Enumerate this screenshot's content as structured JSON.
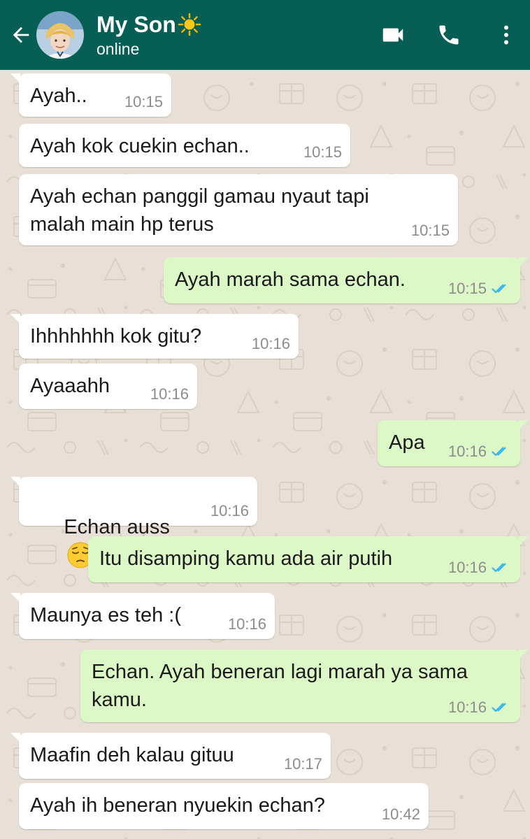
{
  "header": {
    "contact_name": "My Son",
    "status": "online",
    "name_emoji": "sun-icon",
    "icons": [
      "back-arrow-icon",
      "video-call-icon",
      "voice-call-icon",
      "more-options-icon"
    ],
    "colors": {
      "bar": "#075e54",
      "text": "#ffffff"
    }
  },
  "messages": [
    {
      "dir": "in",
      "text": "Ayah..",
      "time": "10:15"
    },
    {
      "dir": "in",
      "text": "Ayah kok cuekin echan..",
      "time": "10:15"
    },
    {
      "dir": "in",
      "text": "Ayah echan panggil gamau nyaut tapi\nmalah main hp terus",
      "time": "10:15"
    },
    {
      "dir": "out",
      "text": "Ayah marah sama echan.",
      "time": "10:15",
      "status": "read"
    },
    {
      "dir": "in",
      "text": "Ihhhhhhh kok gitu?",
      "time": "10:16"
    },
    {
      "dir": "in",
      "text": "Ayaaahh",
      "time": "10:16"
    },
    {
      "dir": "out",
      "text": "Apa",
      "time": "10:16",
      "status": "read"
    },
    {
      "dir": "in",
      "text": "Echan auss",
      "time": "10:16",
      "emoji": "pensive-face-icon"
    },
    {
      "dir": "out",
      "text": "Itu disamping kamu ada air putih",
      "time": "10:16",
      "status": "read"
    },
    {
      "dir": "in",
      "text": "Maunya es teh :(",
      "time": "10:16"
    },
    {
      "dir": "out",
      "text": "Echan. Ayah beneran lagi marah ya sama\nkamu.",
      "time": "10:16",
      "status": "read"
    },
    {
      "dir": "in",
      "text": "Maafin deh kalau gituu",
      "time": "10:17"
    },
    {
      "dir": "in",
      "text": "Ayah ih beneran nyuekin echan?",
      "time": "10:42"
    }
  ],
  "colors": {
    "incoming_bubble": "#ffffff",
    "outgoing_bubble": "#dcf8c6",
    "read_ticks": "#34b7f1",
    "wallpaper": "#e8e0d6"
  }
}
